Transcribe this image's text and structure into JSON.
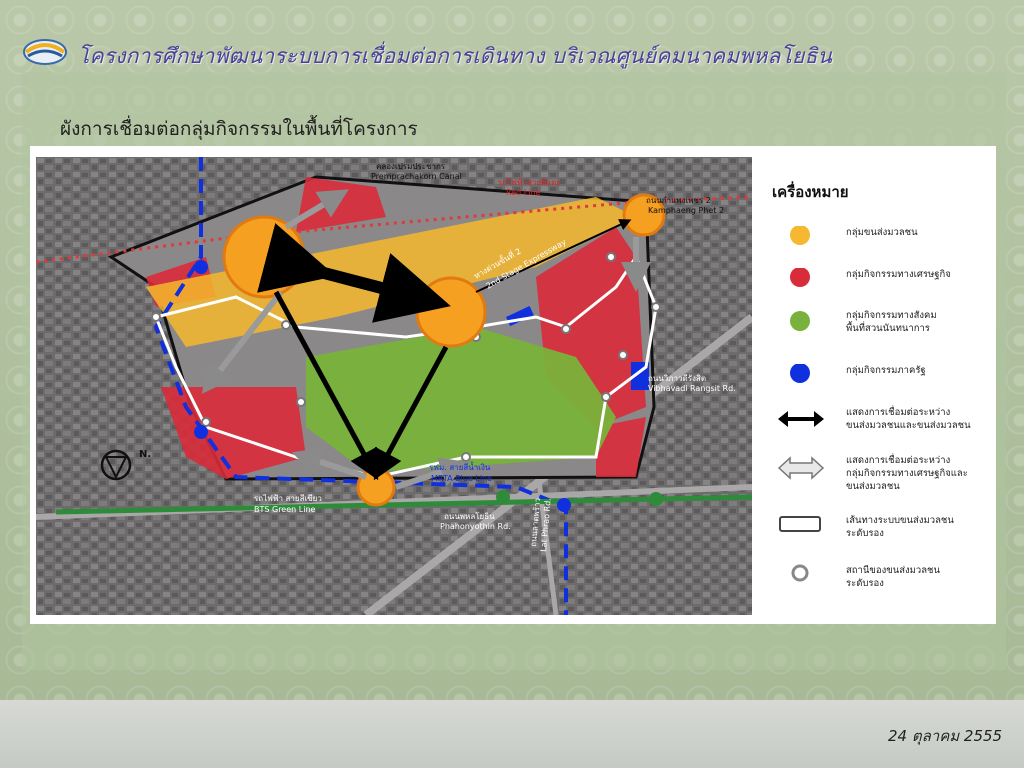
{
  "header": {
    "title": "โครงการศึกษาพัฒนาระบบการเชื่อมต่อการเดินทาง บริเวณศูนย์คมนาคมพหลโยธิน"
  },
  "subtitle": "ผังการเชื่อมต่อกลุ่มกิจกรรมในพื้นที่โครงการ",
  "legend": {
    "title": "เครื่องหมาย",
    "items": [
      {
        "label_1": "กลุ่มขนส่งมวลชน",
        "label_2": "",
        "label_3": "",
        "symbol": "yellow-circle",
        "color": "#f5b82e"
      },
      {
        "label_1": "กลุ่มกิจกรรมทางเศรษฐกิจ",
        "label_2": "",
        "label_3": "",
        "symbol": "red-circle",
        "color": "#d92b3a"
      },
      {
        "label_1": "กลุ่มกิจกรรมทางสังคม",
        "label_2": "พื้นที่สวนนันทนาการ",
        "label_3": "",
        "symbol": "green-circle",
        "color": "#79b23a"
      },
      {
        "label_1": "กลุ่มกิจกรรมภาครัฐ",
        "label_2": "",
        "label_3": "",
        "symbol": "blue-circle",
        "color": "#1030e0"
      },
      {
        "label_1": "แสดงการเชื่อมต่อระหว่าง",
        "label_2": "ขนส่งมวลชนและขนส่งมวลชน",
        "label_3": "",
        "symbol": "black-double-arrow",
        "color": "#000000"
      },
      {
        "label_1": "แสดงการเชื่อมต่อระหว่าง",
        "label_2": "กลุ่มกิจกรรมทางเศรษฐกิจและ",
        "label_3": "ขนส่งมวลชน",
        "symbol": "gray-double-arrow",
        "color": "#9a9a9a"
      },
      {
        "label_1": "เส้นทางระบบขนส่งมวลชน",
        "label_2": "ระดับรอง",
        "label_3": "",
        "symbol": "rounded-rectangle",
        "color": "#444444"
      },
      {
        "label_1": "สถานีของขนส่งมวลชน",
        "label_2": "ระดับรอง",
        "label_3": "",
        "symbol": "ring",
        "color": "#888888"
      }
    ]
  },
  "map": {
    "labels": {
      "canal_th": "คลองเปรมประชากร",
      "canal_en": "Premprachakorn Canal",
      "redline_th": "รถไฟฟ้าสายสีแดง",
      "redline_en": "Red Line",
      "kamphaeng_th": "ถนนกำแพงเพชร 2",
      "kamphaeng_en": "Kamphaeng Phet 2",
      "expressway_th": "ทางด่วนขั้นที่ 2",
      "expressway_en": "2nd Stage Expressway",
      "vibhavadi_th": "ถนนวิภาวดีรังสิต",
      "vibhavadi_en": "Vibhavadi Rangsit Rd.",
      "mrta_th": "รฟม. สายสีน้ำเงิน",
      "mrta_en": "MRTA Blue Line",
      "bts_th": "รถไฟฟ้า สายสีเขียว",
      "bts_en": "BTS Green Line",
      "phahon_th": "ถนนพหลโยธิน",
      "phahon_en": "Phahonyothin Rd.",
      "ladprao_th": "ถนนลาดพร้าว",
      "ladprao_en": "Lat Phrao Rd.",
      "north": "N."
    },
    "colors": {
      "transit": "#f5b82e",
      "economic": "#d92b3a",
      "social": "#79b23a",
      "government": "#1030e0",
      "base": "#6b6b6b"
    }
  },
  "footer": {
    "date": "24 ตุลาคม 2555"
  }
}
